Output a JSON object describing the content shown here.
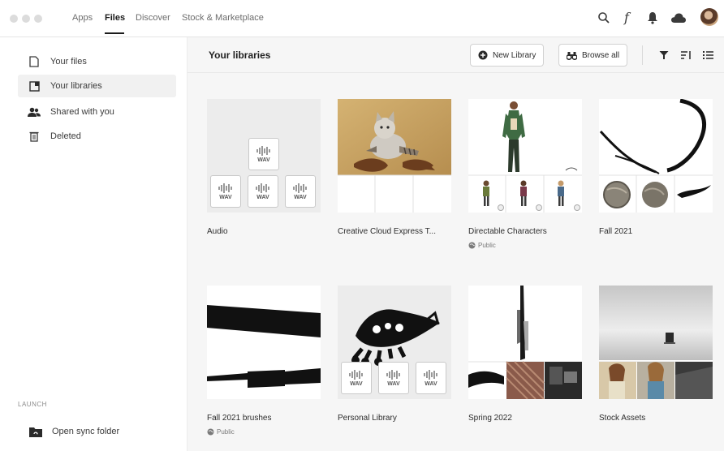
{
  "nav": {
    "tabs": [
      {
        "label": "Apps"
      },
      {
        "label": "Files"
      },
      {
        "label": "Discover"
      },
      {
        "label": "Stock & Marketplace"
      }
    ],
    "active_tab": "Files"
  },
  "sidebar": {
    "items": [
      {
        "label": "Your files",
        "icon": "file-icon"
      },
      {
        "label": "Your libraries",
        "icon": "library-icon"
      },
      {
        "label": "Shared with you",
        "icon": "people-icon"
      },
      {
        "label": "Deleted",
        "icon": "trash-icon"
      }
    ],
    "launch_label": "LAUNCH",
    "open_sync_label": "Open sync folder"
  },
  "header": {
    "title": "Your libraries",
    "new_library_label": "New Library",
    "browse_all_label": "Browse all"
  },
  "libraries": [
    {
      "title": "Audio",
      "sub": ""
    },
    {
      "title": "Creative Cloud Express T...",
      "sub": ""
    },
    {
      "title": "Directable Characters",
      "sub": "Public"
    },
    {
      "title": "Fall 2021",
      "sub": ""
    },
    {
      "title": "Fall 2021 brushes",
      "sub": "Public"
    },
    {
      "title": "Personal Library",
      "sub": ""
    },
    {
      "title": "Spring 2022",
      "sub": ""
    },
    {
      "title": "Stock Assets",
      "sub": ""
    }
  ],
  "wav_label": "WAV",
  "colors": {
    "accent": "#1b1b1b",
    "sidebar_active": "#f1f1f1",
    "main_bg": "#f6f6f6"
  }
}
